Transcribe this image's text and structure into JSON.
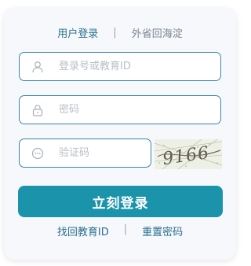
{
  "tabs": {
    "active": "用户登录",
    "separator": "|",
    "inactive": "外省回海淀"
  },
  "form": {
    "account_placeholder": "登录号或教育ID",
    "password_placeholder": "密码",
    "captcha_placeholder": "验证码",
    "captcha_text": "9166",
    "login_label": "立刻登录"
  },
  "links": {
    "retrieve_id": "找回教育ID",
    "separator": "|",
    "reset_password": "重置密码"
  },
  "icons": {
    "account": "user-icon",
    "password": "lock-icon",
    "captcha": "chat-bubble-icon"
  },
  "colors": {
    "accent": "#1b93aa",
    "link": "#2a6f8f",
    "field_border": "#3a86ad",
    "card_background": "#f6f8fb"
  }
}
